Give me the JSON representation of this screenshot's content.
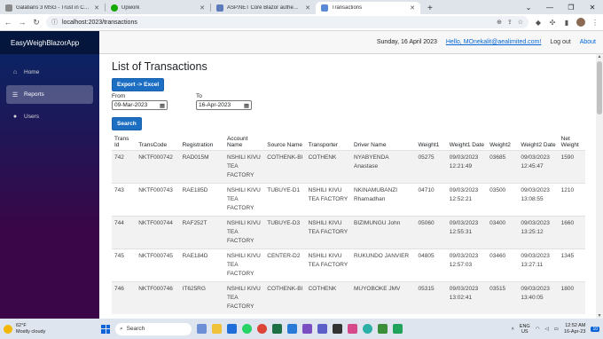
{
  "browser": {
    "tabs": [
      {
        "title": "Galatians 3 MSG - Trust in Christ",
        "favicon_color": "#8a8a8a"
      },
      {
        "title": "Upwork",
        "favicon_color": "#14a800"
      },
      {
        "title": "ASP.NET Core Blazor authenticat",
        "favicon_color": "#5b7bbd"
      },
      {
        "title": "Transactions",
        "favicon_color": "#5a8ad6",
        "active": true
      }
    ],
    "url": "localhost:2023/transactions"
  },
  "sidebar": {
    "brand": "EasyWeighBlazorApp",
    "items": [
      {
        "label": "Home",
        "icon": "home-icon"
      },
      {
        "label": "Reports",
        "icon": "list-icon",
        "active": true
      },
      {
        "label": "Users",
        "icon": "person-icon"
      }
    ]
  },
  "topbar": {
    "date": "Sunday, 16 April 2023",
    "user": "Hello, MOnekalit@aealimited.com!",
    "logout": "Log out",
    "about": "About"
  },
  "page": {
    "title": "List of Transactions",
    "export_label": "Export -> Excel",
    "from_label": "From",
    "from_value": "09-Mar-2023",
    "to_label": "To",
    "to_value": "16-Apr-2023",
    "search_label": "Search"
  },
  "table": {
    "headers": [
      "Trans Id",
      "TransCode",
      "Registration",
      "Account Name",
      "Source Name",
      "Transporter",
      "Driver Name",
      "Weight1",
      "Weight1 Date",
      "Weight2",
      "Weight2 Date",
      "Net Weight"
    ],
    "rows": [
      [
        "742",
        "NKTF000742",
        "RAD015M",
        "NSHILI KIVU TEA FACTORY",
        "COTHENK-BI",
        "COTHENK",
        "NYABYENDA Anastase",
        "05275",
        "09/03/2023 12:21:49",
        "03685",
        "09/03/2023 12:45:47",
        "1590"
      ],
      [
        "743",
        "NKTF000743",
        "RAE185D",
        "NSHILI KIVU TEA FACTORY",
        "TUBUYE-D1",
        "NSHILI KIVU TEA FACTORY",
        "NKINAMUBANZI Rhamadhan",
        "04710",
        "09/03/2023 12:52:21",
        "03500",
        "09/03/2023 13:08:55",
        "1210"
      ],
      [
        "744",
        "NKTF000744",
        "RAF252T",
        "NSHILI KIVU TEA FACTORY",
        "TUBUYE-D3",
        "NSHILI KIVU TEA FACTORY",
        "BIZIMUNGU John",
        "05060",
        "09/03/2023 12:55:31",
        "03400",
        "09/03/2023 13:25:12",
        "1660"
      ],
      [
        "745",
        "NKTF000745",
        "RAE184D",
        "NSHILI KIVU TEA FACTORY",
        "CENTER-D2",
        "NSHILI KIVU TEA FACTORY",
        "RUKUNDO JANVIER",
        "04805",
        "09/03/2023 12:57:03",
        "03460",
        "09/03/2023 13:27:11",
        "1345"
      ],
      [
        "746",
        "NKTF000746",
        "IT625RG",
        "NSHILI KIVU TEA FACTORY",
        "COTHENK-BI",
        "COTHENK",
        "MUYOBOKE JMV",
        "05315",
        "09/03/2023 13:02:41",
        "03515",
        "09/03/2023 13:40:05",
        "1800"
      ]
    ]
  },
  "taskbar": {
    "temp": "62°F",
    "weather": "Mostly cloudy",
    "search": "Search",
    "lang1": "ENG",
    "lang2": "US",
    "time": "12:52 AM",
    "date": "16-Apr-23",
    "notif": "10"
  }
}
